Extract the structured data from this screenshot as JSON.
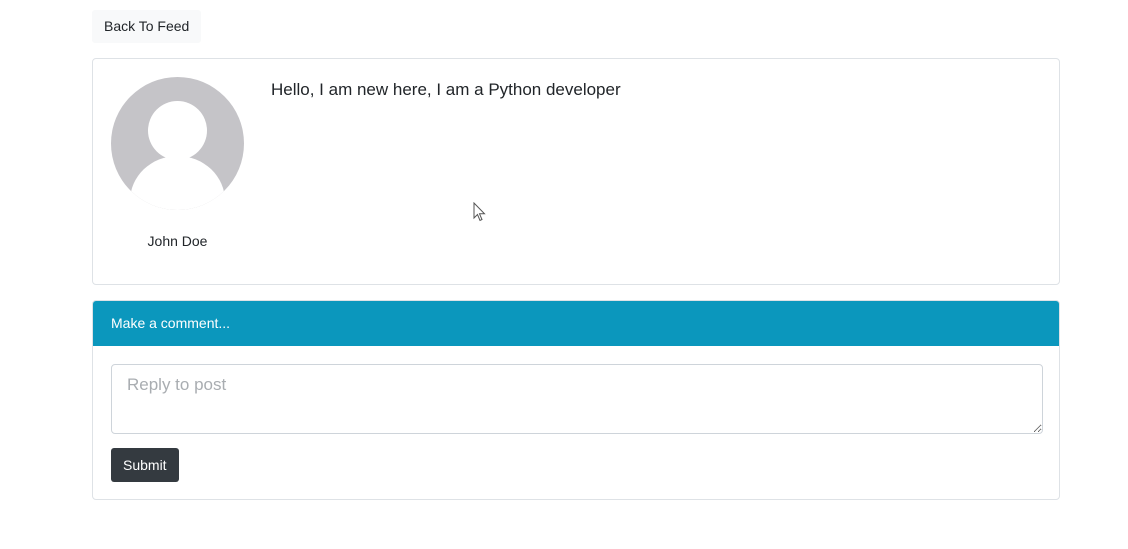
{
  "nav": {
    "back_label": "Back To Feed"
  },
  "post": {
    "avatar_icon": "default-user-avatar-icon",
    "author": "John Doe",
    "content": "Hello, I am new here, I am a Python developer"
  },
  "comment": {
    "header": "Make a comment...",
    "placeholder": "Reply to post",
    "value": "",
    "submit_label": "Submit"
  },
  "colors": {
    "header_bg": "#0b97bd",
    "submit_bg": "#343a40",
    "avatar_bg": "#c5c4c8"
  }
}
